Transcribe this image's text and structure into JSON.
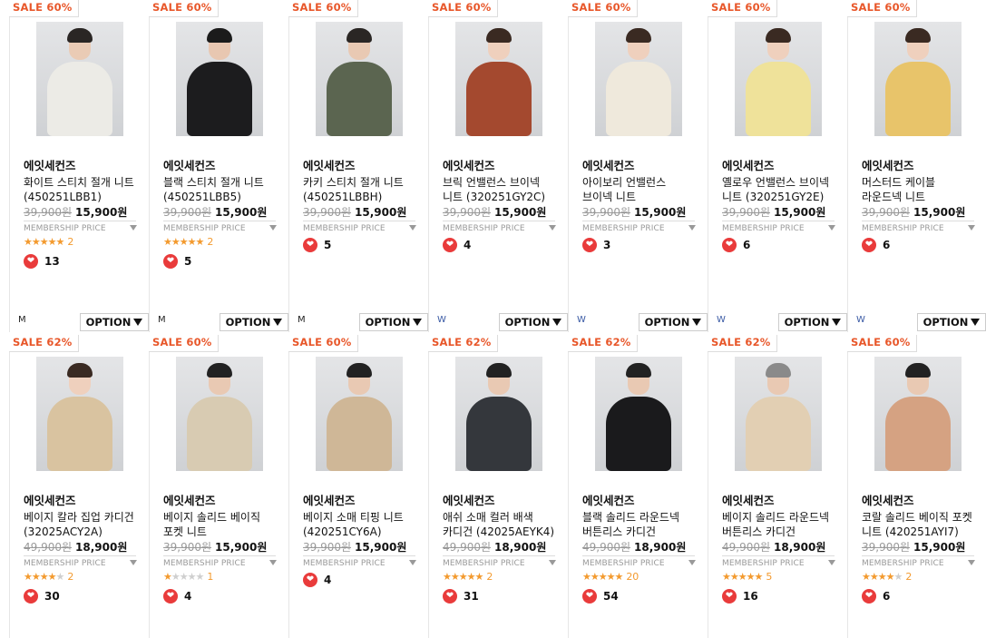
{
  "colors": {
    "sale": "#e8572a",
    "star": "#f39a2e",
    "heart": "#e93b3b",
    "size_w": "#3b5ba5"
  },
  "labels": {
    "membership": "MEMBERSHIP PRICE",
    "option": "OPTION"
  },
  "rows": [
    [
      {
        "sale": "SALE 60%",
        "brand": "에잇세컨즈",
        "name": "화이트 스티치 절개 니트 (450251LBB1)",
        "orig": "39,900원",
        "price": "15,900원",
        "stars": 5,
        "reviews": "2",
        "likes": "13",
        "size": "M",
        "shirt": "#ecebe6",
        "hair": "#2a2624",
        "skin": "#eacbb5"
      },
      {
        "sale": "SALE 60%",
        "brand": "에잇세컨즈",
        "name": "블랙 스티치 절개 니트 (450251LBB5)",
        "orig": "39,900원",
        "price": "15,900원",
        "stars": 4.5,
        "reviews": "2",
        "likes": "5",
        "size": "M",
        "shirt": "#1c1c1e",
        "hair": "#1b1b1b",
        "skin": "#e8c7b1"
      },
      {
        "sale": "SALE 60%",
        "brand": "에잇세컨즈",
        "name": "카키 스티치 절개 니트 (450251LBBH)",
        "orig": "39,900원",
        "price": "15,900원",
        "stars": 0,
        "reviews": "",
        "likes": "5",
        "size": "M",
        "shirt": "#5b6550",
        "hair": "#2a2624",
        "skin": "#e9c9b3"
      },
      {
        "sale": "SALE 60%",
        "brand": "에잇세컨즈",
        "name": "브릭 언밸런스 브이넥 니트 (320251GY2C)",
        "orig": "39,900원",
        "price": "15,900원",
        "stars": 0,
        "reviews": "",
        "likes": "4",
        "size": "W",
        "shirt": "#a4492f",
        "hair": "#3a2a22",
        "skin": "#efd0bd"
      },
      {
        "sale": "SALE 60%",
        "brand": "에잇세컨즈",
        "name": "아이보리 언밸런스 브이넥 니트",
        "orig": "39,900원",
        "price": "15,900원",
        "stars": 0,
        "reviews": "",
        "likes": "3",
        "size": "W",
        "shirt": "#efe9dc",
        "hair": "#3a2a22",
        "skin": "#efd0bd"
      },
      {
        "sale": "SALE 60%",
        "brand": "에잇세컨즈",
        "name": "옐로우 언밸런스 브이넥 니트 (320251GY2E)",
        "orig": "39,900원",
        "price": "15,900원",
        "stars": 0,
        "reviews": "",
        "likes": "6",
        "size": "W",
        "shirt": "#efe29a",
        "hair": "#3a2a22",
        "skin": "#efd0bd"
      },
      {
        "sale": "SALE 60%",
        "brand": "에잇세컨즈",
        "name": "머스터드 케이블 라운드넥 니트",
        "orig": "39,900원",
        "price": "15,900원",
        "stars": 0,
        "reviews": "",
        "likes": "6",
        "size": "W",
        "shirt": "#e8c46a",
        "hair": "#3a2a22",
        "skin": "#efd0bd"
      }
    ],
    [
      {
        "sale": "SALE 62%",
        "brand": "에잇세컨즈",
        "name": "베이지 칼라 집업 카디건 (32025ACY2A)",
        "orig": "49,900원",
        "price": "18,900원",
        "stars": 4,
        "reviews": "2",
        "likes": "30",
        "shirt": "#d9c3a0",
        "hair": "#3a2a22",
        "skin": "#efd0bd"
      },
      {
        "sale": "SALE 60%",
        "brand": "에잇세컨즈",
        "name": "베이지 솔리드 베이직 포켓 니트",
        "orig": "39,900원",
        "price": "15,900원",
        "stars": 1,
        "reviews": "1",
        "likes": "4",
        "shirt": "#d8cbb2",
        "hair": "#222",
        "skin": "#e9c9b3"
      },
      {
        "sale": "SALE 60%",
        "brand": "에잇세컨즈",
        "name": "베이지 소매 티핑 니트 (420251CY6A)",
        "orig": "39,900원",
        "price": "15,900원",
        "stars": 0,
        "reviews": "",
        "likes": "4",
        "shirt": "#cfb797",
        "hair": "#222",
        "skin": "#e9c9b3"
      },
      {
        "sale": "SALE 62%",
        "brand": "에잇세컨즈",
        "name": "애쉬 소매 컬러 배색 카디건 (42025AEYK4)",
        "orig": "49,900원",
        "price": "18,900원",
        "stars": 5,
        "reviews": "2",
        "likes": "31",
        "shirt": "#34373c",
        "hair": "#222",
        "skin": "#e9c9b3"
      },
      {
        "sale": "SALE 62%",
        "brand": "에잇세컨즈",
        "name": "블랙 솔리드 라운드넥 버튼리스 카디건",
        "orig": "49,900원",
        "price": "18,900원",
        "stars": 5,
        "reviews": "20",
        "likes": "54",
        "shirt": "#1a1a1c",
        "hair": "#222",
        "skin": "#e9c9b3"
      },
      {
        "sale": "SALE 62%",
        "brand": "에잇세컨즈",
        "name": "베이지 솔리드 라운드넥 버튼리스 카디건",
        "orig": "49,900원",
        "price": "18,900원",
        "stars": 5,
        "reviews": "5",
        "likes": "16",
        "shirt": "#e2cfb3",
        "hair": "#8a8a8a",
        "skin": "#e9c9b3"
      },
      {
        "sale": "SALE 60%",
        "brand": "에잇세컨즈",
        "name": "코랄 솔리드 베이직 포켓 니트 (420251AYI7)",
        "orig": "39,900원",
        "price": "15,900원",
        "stars": 3.5,
        "reviews": "2",
        "likes": "6",
        "shirt": "#d5a282",
        "hair": "#222",
        "skin": "#e9c9b3"
      }
    ]
  ]
}
